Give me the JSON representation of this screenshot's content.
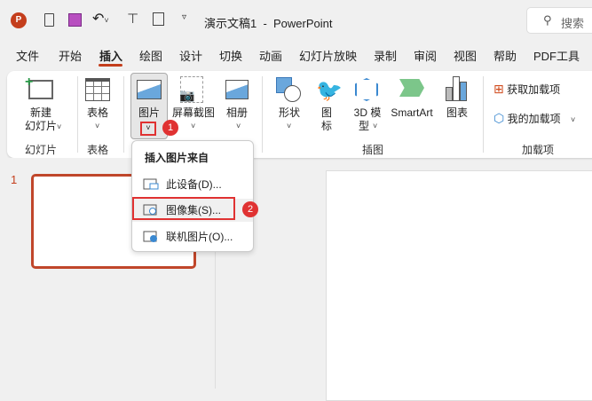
{
  "titlebar": {
    "doc_title": "演示文稿1  -  PowerPoint",
    "search_placeholder": "搜索"
  },
  "tabs": [
    "文件",
    "开始",
    "插入",
    "绘图",
    "设计",
    "切换",
    "动画",
    "幻灯片放映",
    "录制",
    "审阅",
    "视图",
    "帮助",
    "PDF工具"
  ],
  "active_tab": "插入",
  "ribbon": {
    "new_slide": "新建\n幻灯片",
    "table": "表格",
    "picture": "图片",
    "screenshot": "屏幕截图",
    "album": "相册",
    "shapes": "形状",
    "icons_1": "图",
    "icons_2": "标",
    "model_1": "3D 模",
    "model_2": "型",
    "smartart": "SmartArt",
    "chart": "图表",
    "get_addins": "获取加载项",
    "my_addins": "我的加载项",
    "groups": {
      "slides": "幻灯片",
      "tables": "表格",
      "illustrations": "插图",
      "addins": "加载项"
    }
  },
  "menu": {
    "header": "插入图片来自",
    "items": [
      "此设备(D)...",
      "图像集(S)...",
      "联机图片(O)..."
    ]
  },
  "badges": [
    "1",
    "2"
  ],
  "slide_number": "1",
  "colors": {
    "accent": "#c43e1c",
    "badge": "#e03232"
  }
}
